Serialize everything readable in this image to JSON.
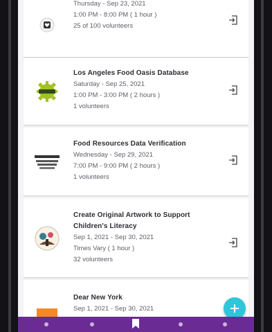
{
  "opportunities": [
    {
      "title": "",
      "date": "Thursday - Sep 23, 2021",
      "time": "1:00 PM - 8:00 PM ( 1 hour )",
      "volunteers": "25 of 100 volunteers",
      "logo_icon": "heart-badge-icon"
    },
    {
      "title": "Los Angeles Food Oasis Database",
      "date": "Saturday - Sep 25, 2021",
      "time": "1:00 PM - 3:00 PM ( 2 hours )",
      "volunteers": "1 volunteers",
      "logo_icon": "gear-badge-icon"
    },
    {
      "title": "Food Resources Data Verification",
      "date": "Wednesday - Sep 29, 2021",
      "time": "7:00 PM - 9:00 PM ( 2 hours )",
      "volunteers": "1 volunteers",
      "logo_icon": "text-logo-icon"
    },
    {
      "title": "Create Original Artwork to Support Children's Literacy",
      "date": "Sep 1, 2021 - Sep 30, 2021",
      "time": "Times Vary ( 1 hour )",
      "volunteers": "32 volunteers",
      "logo_icon": "illustration-badge-icon"
    },
    {
      "title": "Dear New York",
      "date": "Sep 1, 2021 - Sep 30, 2021",
      "time": "",
      "volunteers": "",
      "logo_icon": "orange-tile-icon"
    }
  ],
  "colors": {
    "nav_bar": "#6a2b94",
    "fab": "#2ec6d9",
    "card_bg": "#ffffff",
    "screen_bg": "#f4f4f6"
  },
  "icons": {
    "card_action": "checkin-icon",
    "fab": "plus-icon",
    "nav_center": "bookmark-icon"
  }
}
